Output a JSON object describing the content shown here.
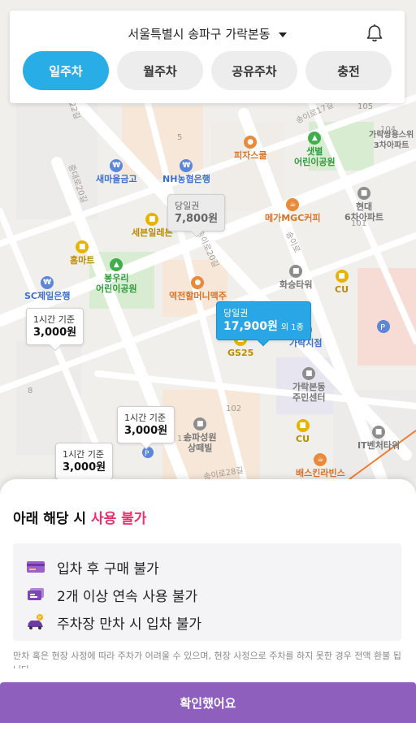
{
  "header": {
    "location": "서울특별시 송파구 가락본동",
    "tabs": [
      {
        "label": "일주차",
        "active": true
      },
      {
        "label": "월주차",
        "active": false
      },
      {
        "label": "공유주차",
        "active": false
      },
      {
        "label": "충전",
        "active": false
      }
    ]
  },
  "map": {
    "pois": [
      {
        "label": "새마을금고",
        "icon": "won-icon"
      },
      {
        "label": "NH농협은행",
        "icon": "won-icon"
      },
      {
        "label": "피자스쿨",
        "icon": "food-icon"
      },
      {
        "label": "샛별\n어린이공원",
        "icon": "park-icon"
      },
      {
        "label": "현대\n6차아파트",
        "icon": "building-icon"
      },
      {
        "label": "가락쌍용스위\n3차아파트",
        "icon": "building-icon"
      },
      {
        "label": "세븐일레븐",
        "icon": "store-icon"
      },
      {
        "label": "메가MGC커피",
        "icon": "cafe-icon"
      },
      {
        "label": "홈마트",
        "icon": "store-icon"
      },
      {
        "label": "SC제일은행",
        "icon": "won-icon"
      },
      {
        "label": "봉우리\n어린이공원",
        "icon": "park-icon"
      },
      {
        "label": "역전할머니맥주",
        "icon": "food-icon"
      },
      {
        "label": "화승타워",
        "icon": "building-icon"
      },
      {
        "label": "CU",
        "icon": "store-icon"
      },
      {
        "label": "가락지점",
        "icon": "won-icon"
      },
      {
        "label": "GS25",
        "icon": "store-icon"
      },
      {
        "label": "가락본동\n주민센터",
        "icon": "building-icon"
      },
      {
        "label": "송파성원\n상떼빌",
        "icon": "building-icon"
      },
      {
        "label": "CU",
        "icon": "store-icon"
      },
      {
        "label": "IT벤처타워",
        "icon": "building-icon"
      },
      {
        "label": "배스킨라빈스",
        "icon": "cafe-icon"
      }
    ],
    "roads": [
      "송이로17길",
      "송이로",
      "중대로20길",
      "송이로20길",
      "송이로28길",
      "22길"
    ],
    "numbers": [
      "5",
      "105",
      "104",
      "101",
      "102",
      "8",
      "13"
    ],
    "price_tags": [
      {
        "sub": "당일권",
        "amount": "7,800원",
        "style": "gray"
      },
      {
        "sub": "당일권",
        "amount": "17,900원",
        "extra": "외 1종",
        "style": "active"
      },
      {
        "sub": "1시간 기준",
        "amount": "3,000원",
        "style": "white"
      },
      {
        "sub": "1시간 기준",
        "amount": "3,000원",
        "style": "white"
      },
      {
        "sub": "1시간 기준",
        "amount": "3,000원",
        "style": "white"
      }
    ]
  },
  "sheet": {
    "title_prefix": "아래 해당 시 ",
    "title_warn": "사용 불가",
    "rules": [
      {
        "icon": "credit-card-icon",
        "text": "입차 후 구매 불가"
      },
      {
        "icon": "tickets-icon",
        "text": "2개 이상 연속 사용 불가"
      },
      {
        "icon": "car-parking-icon",
        "text": "주차장 만차 시 입차 불가"
      }
    ],
    "note": "만차 혹은 현장 사정에 따라 주차가 어려울 수 있으며, 현장 사정으로 주차를 하지 못한 경우 전액 환불 됩니다.",
    "confirm_label": "확인했어요"
  },
  "colors": {
    "active_tab": "#29ade6",
    "warn": "#e8306b",
    "confirm": "#8e5fbc",
    "active_tag": "#29a6e6"
  }
}
